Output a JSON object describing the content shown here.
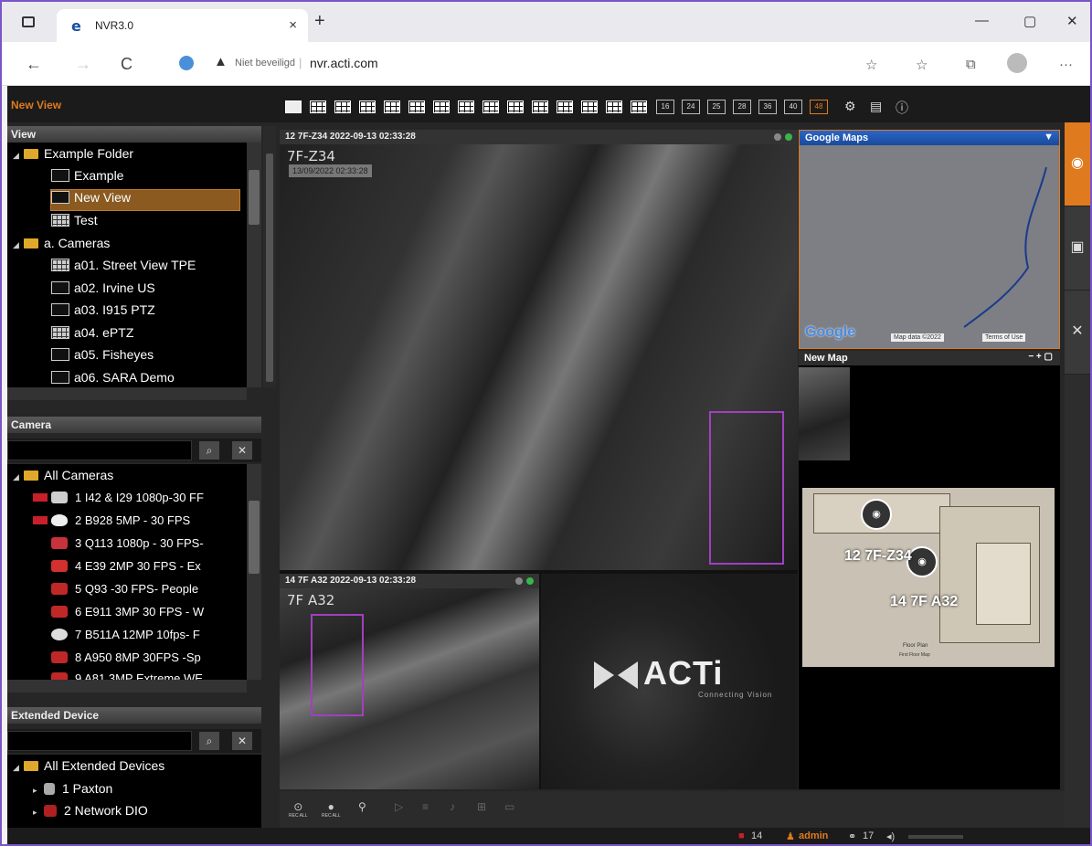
{
  "browser": {
    "tab_title": "NVR3.0",
    "tab_close": "×",
    "new_tab": "+",
    "window_controls": {
      "minimize": "—",
      "maximize": "▢",
      "close": "✕"
    },
    "nav": {
      "back": "←",
      "forward": "→",
      "reload": "C"
    },
    "security_label": "Niet beveiligd",
    "url": "nvr.acti.com",
    "icons": [
      "read-aloud-icon",
      "favorites-icon",
      "collections-icon",
      "profile-icon",
      "more-icon"
    ],
    "more": "···"
  },
  "app": {
    "view_title": "New View",
    "layout_numbers": [
      "16",
      "24",
      "25",
      "28",
      "36",
      "40",
      "48"
    ],
    "view_panel": {
      "header": "View",
      "items": [
        {
          "label": "Example Folder",
          "type": "folder"
        },
        {
          "label": "Example",
          "type": "view"
        },
        {
          "label": "New View",
          "type": "view",
          "selected": true
        },
        {
          "label": "Test",
          "type": "grid"
        },
        {
          "label": "a. Cameras",
          "type": "folder"
        },
        {
          "label": "a01. Street View TPE",
          "type": "grid"
        },
        {
          "label": "a02. Irvine US",
          "type": "view"
        },
        {
          "label": "a03. I915 PTZ",
          "type": "view"
        },
        {
          "label": "a04. ePTZ",
          "type": "grid"
        },
        {
          "label": "a05. Fisheyes",
          "type": "view"
        },
        {
          "label": "a06. SARA Demo",
          "type": "view"
        }
      ]
    },
    "camera_panel": {
      "header": "Camera",
      "root": "All Cameras",
      "items": [
        {
          "label": "1 I42 & I29 1080p-30 FF",
          "rec": true,
          "color": "#cfcfcf"
        },
        {
          "label": "2 B928 5MP - 30 FPS",
          "rec": true,
          "color": "#eeeeee"
        },
        {
          "label": "3 Q113 1080p - 30 FPS-",
          "rec": false,
          "color": "#c8323a"
        },
        {
          "label": "4 E39 2MP 30 FPS - Ex",
          "rec": false,
          "color": "#d43030"
        },
        {
          "label": "5 Q93 -30 FPS- People",
          "rec": false,
          "color": "#c02828"
        },
        {
          "label": "6 E911 3MP 30 FPS - W",
          "rec": false,
          "color": "#c02828"
        },
        {
          "label": "7 B511A 12MP 10fps- F",
          "rec": false,
          "color": "#dddddd"
        },
        {
          "label": "8 A950 8MP 30FPS -Sp",
          "rec": false,
          "color": "#c02828"
        },
        {
          "label": "9 A81 3MP Extreme WE",
          "rec": false,
          "color": "#c02828"
        }
      ]
    },
    "extended_panel": {
      "header": "Extended Device",
      "root": "All Extended Devices",
      "items": [
        {
          "label": "1 Paxton"
        },
        {
          "label": "2 Network DIO"
        }
      ]
    },
    "cameras": {
      "cam1": {
        "header": "12 7F-Z34   2022-09-13 02:33:28",
        "label": "7F-Z34",
        "timestamp": "13/09/2022 02:33:28"
      },
      "cam2": {
        "header": "14 7F A32   2022-09-13 02:33:28",
        "label": "7F A32"
      },
      "brand": "ACTi",
      "brand_tagline": "Connecting Vision"
    },
    "maps": {
      "google_header": "Google Maps",
      "google_logo": "Google",
      "map_data": "Map data ©2022",
      "terms": "Terms of Use",
      "new_map_header": "New Map",
      "floor_labels": [
        "12 7F-Z34",
        "14 7F A32"
      ],
      "floor_caption": [
        "Floor Plan",
        "First Floor Map"
      ]
    },
    "controls": {
      "rec_all": "REC ALL",
      "rec_all_2": "REC ALL"
    },
    "status": {
      "cameras": "14",
      "user": "admin",
      "devices": "17"
    }
  },
  "colors": {
    "accent": "#e07a1f",
    "rec": "#c8202a",
    "online": "#39b54a",
    "frame": "#7a55c8"
  }
}
